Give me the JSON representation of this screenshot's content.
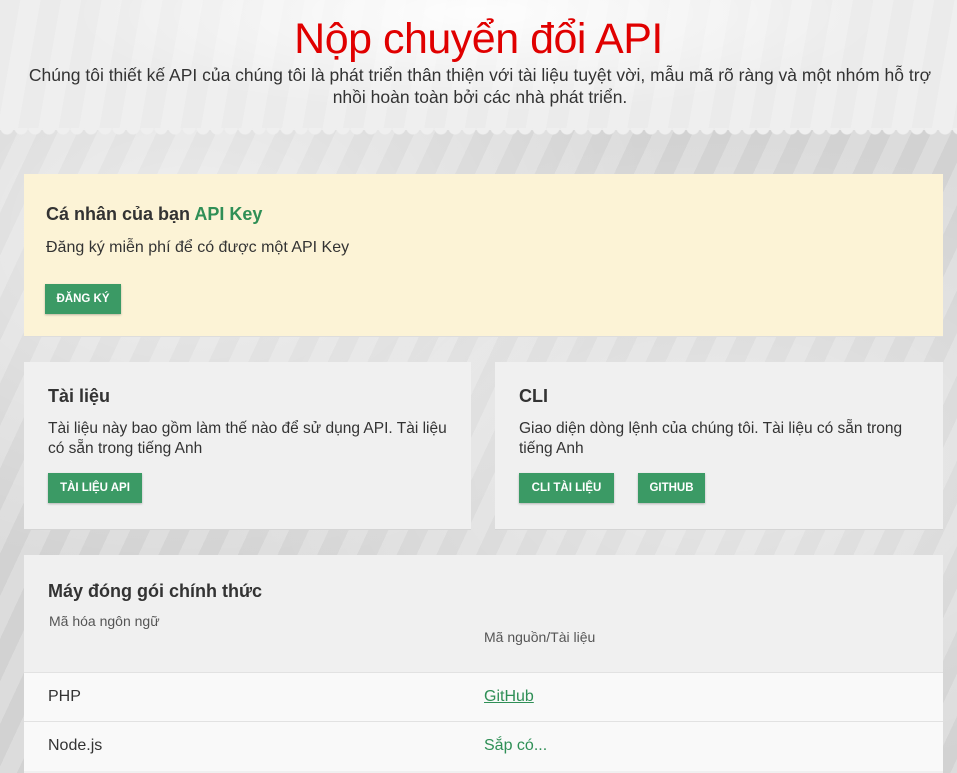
{
  "hero": {
    "title": "Nộp chuyển đổi API",
    "subtitle": "Chúng tôi thiết kế API của chúng tôi là phát triển thân thiện với tài liệu tuyệt vời, mẫu mã rõ ràng và một nhóm hỗ trợ nhồi hoàn toàn bởi các nhà phát triển."
  },
  "api_key_card": {
    "title_prefix": "Cá nhân của bạn",
    "title_accent": "API Key",
    "description": "Đăng ký miễn phí để có được một API Key",
    "button_label": "ĐĂNG KÝ"
  },
  "docs_card": {
    "title": "Tài liệu",
    "description": "Tài liệu này bao gồm làm thế nào để sử dụng API. Tài liệu có sẵn trong tiếng Anh",
    "button_label": "TÀI LIỆU API"
  },
  "cli_card": {
    "title": "CLI",
    "description": "Giao diện dòng lệnh của chúng tôi. Tài liệu có sẵn trong tiếng Anh",
    "cli_button_label": "CLI TÀI LIỆU",
    "github_button_label": "GITHUB"
  },
  "packages_card": {
    "title": "Máy đóng gói chính thức",
    "column_language": "Mã hóa ngôn ngữ",
    "column_source": "Mã nguồn/Tài liệu",
    "rows": [
      {
        "language": "PHP",
        "source": "GitHub"
      },
      {
        "language": "Node.js",
        "source": "Sắp có..."
      }
    ]
  },
  "colors": {
    "title_red": "#e00000",
    "accent_green": "#2f8f56",
    "button_green": "#3b9a65",
    "apikey_card_bg": "#fcf3d6"
  }
}
